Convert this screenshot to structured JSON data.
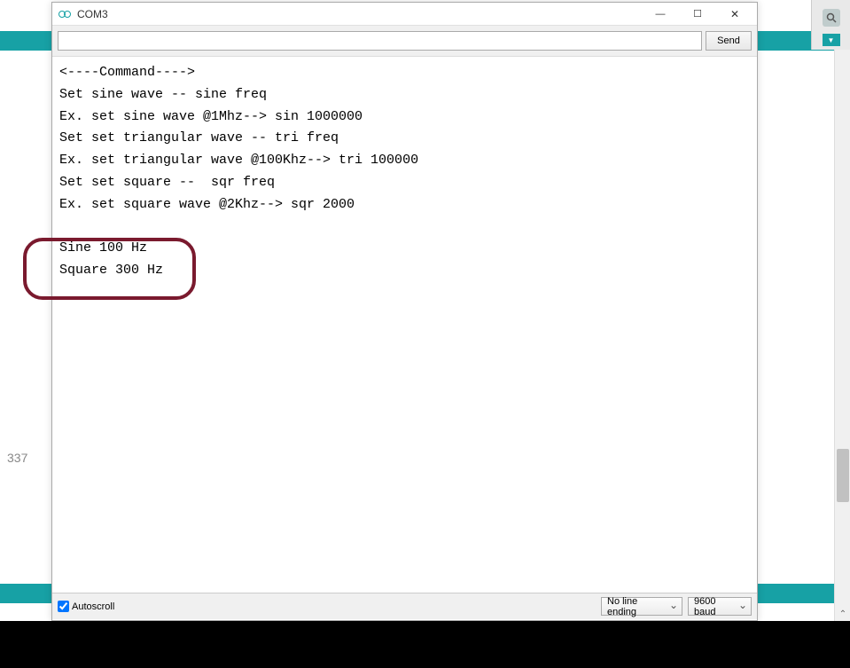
{
  "background": {
    "number": "337"
  },
  "serial_monitor": {
    "title": "COM3",
    "input_value": "",
    "send_label": "Send",
    "output_lines": [
      "<----Command---->",
      "Set sine wave -- sine freq",
      "Ex. set sine wave @1Mhz--> sin 1000000",
      "Set set triangular wave -- tri freq",
      "Ex. set triangular wave @100Khz--> tri 100000",
      "Set set square --  sqr freq",
      "Ex. set square wave @2Khz--> sqr 2000",
      "",
      "Sine 100 Hz",
      "Square 300 Hz"
    ],
    "autoscroll_label": "Autoscroll",
    "autoscroll_checked": true,
    "line_ending": "No line ending",
    "baud_rate": "9600 baud"
  }
}
